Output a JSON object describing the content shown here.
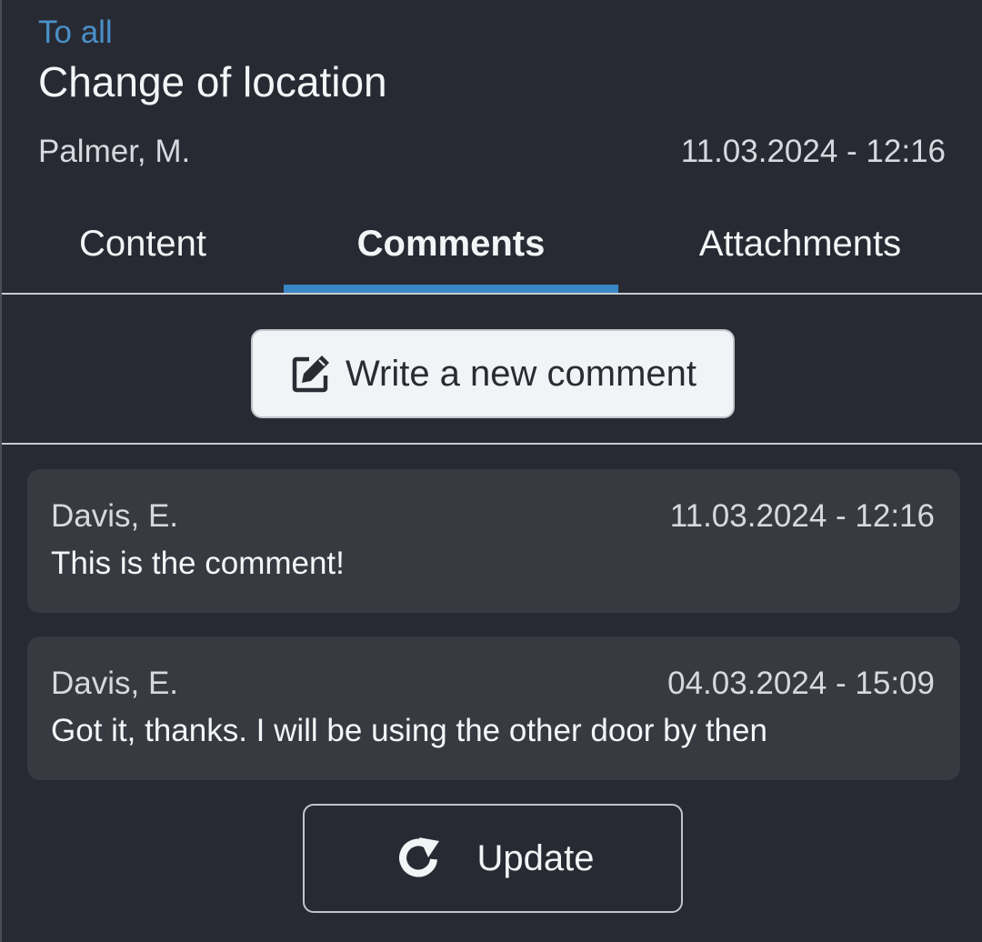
{
  "header": {
    "recipient": "To all",
    "title": "Change of location",
    "author": "Palmer, M.",
    "datetime": "11.03.2024 - 12:16"
  },
  "tabs": [
    {
      "label": "Content",
      "active": false
    },
    {
      "label": "Comments",
      "active": true
    },
    {
      "label": "Attachments",
      "active": false
    }
  ],
  "actions": {
    "write_comment_label": "Write a new comment",
    "write_comment_icon": "edit-icon",
    "update_label": "Update",
    "update_icon": "refresh-icon"
  },
  "comments": [
    {
      "author": "Davis, E.",
      "datetime": "11.03.2024 - 12:16",
      "text": "This is the comment!"
    },
    {
      "author": "Davis, E.",
      "datetime": "04.03.2024 - 15:09",
      "text": "Got it, thanks. I will be using the other door by then"
    }
  ],
  "colors": {
    "background": "#282a33",
    "accent": "#3a87c6",
    "recipient_link": "#4a90c8",
    "card": "#383a42",
    "button_light": "#f2f3f6"
  }
}
